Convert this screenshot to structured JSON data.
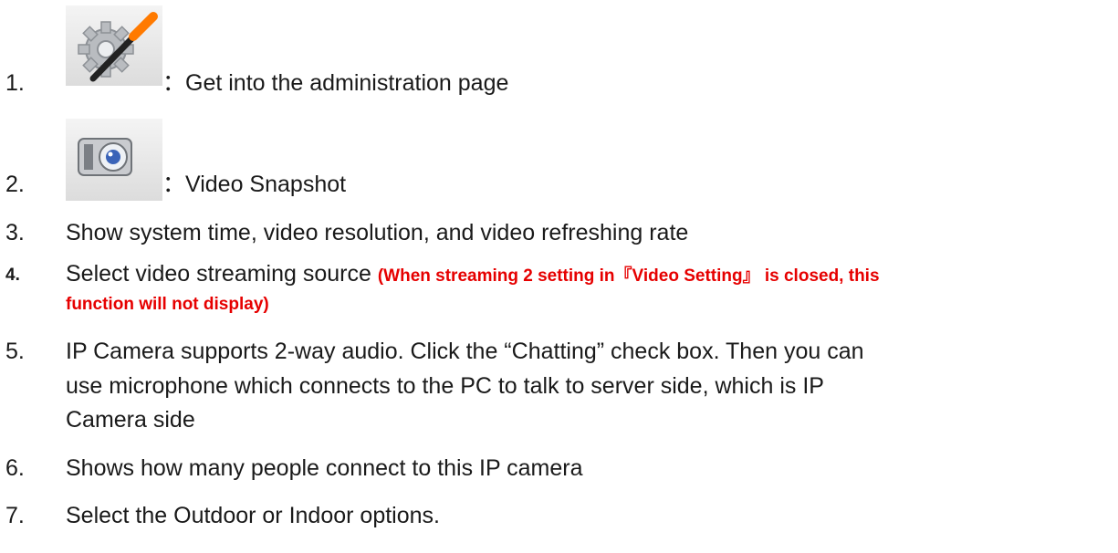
{
  "items": [
    {
      "num": "1.",
      "text": "：Get into the administration page",
      "icon": "admin-settings-icon"
    },
    {
      "num": "2.",
      "text": "：Video Snapshot",
      "icon": "camera-snapshot-icon"
    },
    {
      "num": "3.",
      "text": "Show system time, video resolution, and video refreshing rate"
    },
    {
      "num": "4.",
      "text": "Select video streaming source ",
      "note": "(When streaming 2 setting in『Video Setting』 is closed, this",
      "note_cont": "function will not display)"
    },
    {
      "num": "5.",
      "lines": [
        "IP Camera supports 2-way audio. Click the “Chatting” check box. Then you can",
        "use microphone which connects to the PC to talk to server side, which is IP",
        "Camera side"
      ]
    },
    {
      "num": "6.",
      "text": "Shows how many people connect to this IP camera"
    },
    {
      "num": "7.",
      "text": "Select the Outdoor or Indoor options."
    }
  ],
  "colors": {
    "note": "#e60000",
    "text": "#1a1a1a"
  }
}
